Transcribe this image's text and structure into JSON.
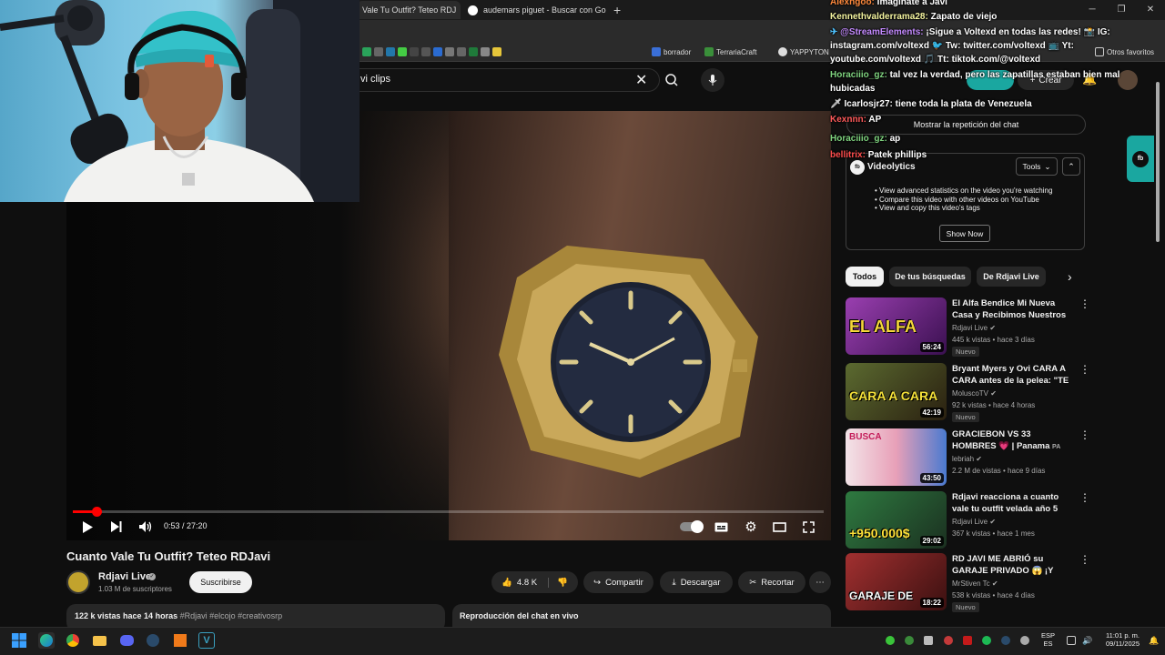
{
  "browser": {
    "tabs": [
      {
        "label": "Vale Tu Outfit? Teteo RDJ",
        "active": true
      },
      {
        "label": "audemars piguet - Buscar con Go",
        "active": false
      }
    ],
    "bookmarks": [
      "borrador",
      "TerrariaCraft",
      "YAPPYTON",
      "Otros favoritos"
    ]
  },
  "youtube": {
    "search": {
      "value": "vi clips"
    },
    "create_label": "Crear",
    "player": {
      "time": "0:53 / 27:20",
      "progress": 0.032
    },
    "video": {
      "title": "Cuanto Vale Tu Outfit? Teteo RDJavi",
      "channel": "Rdjavi Live",
      "subscribers": "1.03 M de suscriptores",
      "subscribe_label": "Suscribirse",
      "likes": "4.8 K",
      "share_label": "Compartir",
      "download_label": "Descargar",
      "clip_label": "Recortar",
      "views_time": "122 k vistas  hace 14 horas",
      "tags": "#Rdjavi #elcojo #creativosrp",
      "chat_replay_title": "Reproducción del chat en vivo"
    },
    "show_replay_label": "Mostrar la repetición del chat",
    "videolytics": {
      "logo": "fb",
      "name": "Videolytics",
      "tools_label": "Tools",
      "features": [
        "View advanced statistics on the video you're watching",
        "Compare this video with other videos on YouTube",
        "View and copy this video's tags"
      ],
      "show_label": "Show Now"
    },
    "chips": [
      "Todos",
      "De tus búsquedas",
      "De Rdjavi Live"
    ],
    "recommendations": [
      {
        "title": "El Alfa Bendice Mi Nueva Casa y Recibimos Nuestros Invitados!...",
        "channel": "Rdjavi Live",
        "meta": "445 k vistas • hace 3 días",
        "badge": "Nuevo",
        "duration": "56:24",
        "overlay": "EL ALFA",
        "color": "#7a2f8f"
      },
      {
        "title": "Bryant Myers y Ovi CARA A CARA antes de la pelea: \"TE ...",
        "channel": "MoluscoTV",
        "meta": "92 k vistas • hace 4 horas",
        "badge": "Nuevo",
        "duration": "42:19",
        "overlay": "CARA A CARA",
        "color": "#4d5a2a"
      },
      {
        "title": "GRACIEBON VS 33 HOMBRES 💗 | Panama",
        "flag": "PA",
        "channel": "lebriah",
        "meta": "2.2 M de vistas • hace 9 días",
        "badge": "",
        "duration": "43:50",
        "overlay": "BUSCA",
        "color": "#c23a6a"
      },
      {
        "title": "Rdjavi reacciona a cuanto vale tu outfit velada año 5",
        "channel": "Rdjavi Live",
        "meta": "367 k vistas • hace 1 mes",
        "badge": "",
        "duration": "29:02",
        "overlay": "+950.000$",
        "color": "#2d6b3a"
      },
      {
        "title": "RD JAVI ME ABRIÓ su GARAJE PRIVADO 😱 ¡Y MANEJÉ sus ...",
        "channel": "MrStiven Tc",
        "meta": "538 k vistas • hace 4 días",
        "badge": "Nuevo",
        "duration": "18:22",
        "overlay": "GARAJE DE",
        "color": "#8a2a2a"
      }
    ]
  },
  "chat": [
    {
      "user": "Alexngoo:",
      "text": "Imaginate a Javi",
      "color": "#ff8a3d"
    },
    {
      "user": "Kennethvalderrama28:",
      "text": "Zapato de viejo",
      "color": "#f5f5a0"
    },
    {
      "user": "@StreamElements:",
      "text": "¡Sigue a Voltexd en todas las redes! 📸 IG: instagram.com/voltexd 🐦 Tw: twitter.com/voltexd 📺 Yt: youtube.com/voltexd 🎵 Tt: tiktok.com/@voltexd",
      "color": "#c48bff"
    },
    {
      "user": "Horaciiio_gz:",
      "text": "tal vez la verdad, pero las zapatillas estaban bien mal hubicadas",
      "color": "#7fd37f"
    },
    {
      "user": "Icarlosjr27:",
      "text": "tiene toda la plata de Venezuela",
      "color": "#ffffff"
    },
    {
      "user": "Kexnnn:",
      "text": "AP",
      "color": "#ff5a5a"
    },
    {
      "user": "Horaciiio_gz:",
      "text": "ap",
      "color": "#7fd37f"
    },
    {
      "user": "bellitrix:",
      "text": "Patek phillips",
      "color": "#ff4d4d"
    }
  ],
  "taskbar": {
    "lang_top": "ESP",
    "lang_bottom": "ES",
    "time": "11:01 p. m.",
    "date": "09/11/2025"
  }
}
